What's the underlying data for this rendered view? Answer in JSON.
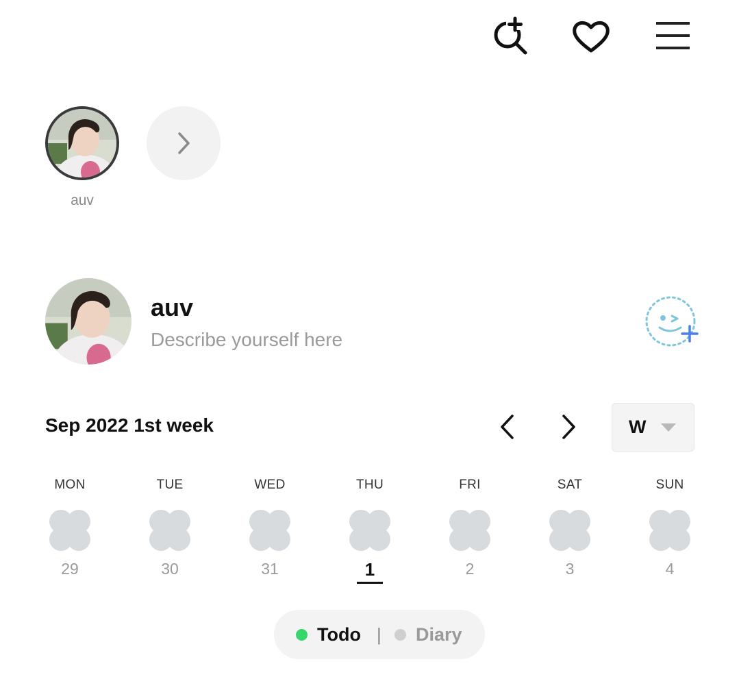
{
  "header": {
    "icons": [
      "search-plus-icon",
      "heart-icon",
      "menu-icon"
    ]
  },
  "friends": {
    "items": [
      {
        "name": "auv"
      }
    ],
    "more_icon": "chevron-right-icon"
  },
  "profile": {
    "name": "auv",
    "bio_placeholder": "Describe yourself here",
    "emoji_button_icon": "emoji-add-icon"
  },
  "calendar": {
    "title": "Sep 2022 1st week",
    "view_mode": "W",
    "days": [
      {
        "label": "MON",
        "date": "29"
      },
      {
        "label": "TUE",
        "date": "30"
      },
      {
        "label": "WED",
        "date": "31"
      },
      {
        "label": "THU",
        "date": "1"
      },
      {
        "label": "FRI",
        "date": "2"
      },
      {
        "label": "SAT",
        "date": "3"
      },
      {
        "label": "SUN",
        "date": "4"
      }
    ],
    "today_index": 3
  },
  "toggle": {
    "todo_label": "Todo",
    "diary_label": "Diary",
    "separator": "|",
    "active": "todo"
  },
  "colors": {
    "todo_dot": "#35d66a",
    "diary_dot": "#cfcfcf",
    "flower": "#d8dbde",
    "emoji_accent": "#7fc6dc",
    "emoji_plus": "#4a7ff0"
  }
}
